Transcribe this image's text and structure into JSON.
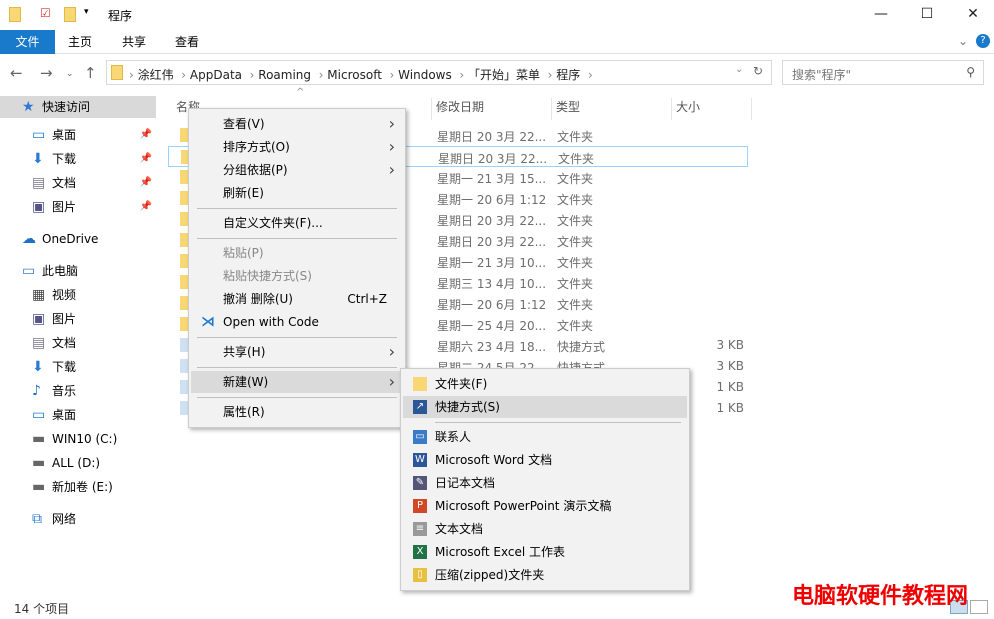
{
  "window": {
    "title": "程序",
    "minimize": "—",
    "maximize": "☐",
    "close": "✕"
  },
  "ribbon": {
    "tabs": [
      "文件",
      "主页",
      "共享",
      "查看"
    ]
  },
  "address": {
    "crumbs": [
      "涂红伟",
      "AppData",
      "Roaming",
      "Microsoft",
      "Windows",
      "「开始」菜单",
      "程序"
    ],
    "refresh": "↻"
  },
  "search": {
    "placeholder": "搜索\"程序\""
  },
  "sidebar": {
    "items": [
      {
        "label": "快速访问",
        "icon": "star-icon"
      },
      {
        "label": "桌面",
        "icon": "desktop-icon",
        "pinned": true
      },
      {
        "label": "下载",
        "icon": "download-icon",
        "pinned": true
      },
      {
        "label": "文档",
        "icon": "document-icon",
        "pinned": true
      },
      {
        "label": "图片",
        "icon": "picture-icon",
        "pinned": true
      },
      {
        "label": "OneDrive",
        "icon": "cloud-icon"
      },
      {
        "label": "此电脑",
        "icon": "computer-icon"
      },
      {
        "label": "视频",
        "icon": "video-icon"
      },
      {
        "label": "图片",
        "icon": "picture-icon"
      },
      {
        "label": "文档",
        "icon": "document-icon"
      },
      {
        "label": "下载",
        "icon": "download-icon"
      },
      {
        "label": "音乐",
        "icon": "music-icon"
      },
      {
        "label": "桌面",
        "icon": "desktop-icon"
      },
      {
        "label": "WIN10 (C:)",
        "icon": "drive-icon"
      },
      {
        "label": "ALL (D:)",
        "icon": "drive-icon"
      },
      {
        "label": "新加卷 (E:)",
        "icon": "drive-icon"
      },
      {
        "label": "网络",
        "icon": "network-icon"
      }
    ]
  },
  "columns": [
    "名称",
    "修改日期",
    "类型",
    "大小"
  ],
  "files": [
    {
      "date": "星期日 20 3月 22...",
      "type": "文件夹",
      "size": ""
    },
    {
      "date": "星期日 20 3月 22...",
      "type": "文件夹",
      "size": ""
    },
    {
      "date": "星期一 21 3月 15...",
      "type": "文件夹",
      "size": ""
    },
    {
      "date": "星期一 20 6月 1:12",
      "type": "文件夹",
      "size": ""
    },
    {
      "date": "星期日 20 3月 22...",
      "type": "文件夹",
      "size": ""
    },
    {
      "date": "星期日 20 3月 22...",
      "type": "文件夹",
      "size": ""
    },
    {
      "date": "星期一 21 3月 10...",
      "type": "文件夹",
      "size": ""
    },
    {
      "date": "星期三 13 4月 10...",
      "type": "文件夹",
      "size": ""
    },
    {
      "date": "星期一 20 6月 1:12",
      "type": "文件夹",
      "size": ""
    },
    {
      "date": "星期一 25 4月 20...",
      "type": "文件夹",
      "size": ""
    },
    {
      "date": "星期六 23 4月 18...",
      "type": "快捷方式",
      "size": "3 KB"
    },
    {
      "date": "星期二 24 5月 22...",
      "type": "快捷方式",
      "size": "3 KB"
    },
    {
      "date": "",
      "type": "",
      "size": "1 KB"
    },
    {
      "date": "",
      "type": "",
      "size": "1 KB"
    }
  ],
  "context_menu": {
    "items": [
      "查看(V)",
      "排序方式(O)",
      "分组依据(P)",
      "刷新(E)",
      "自定义文件夹(F)...",
      "粘贴(P)",
      "粘贴快捷方式(S)",
      "撤消 删除(U)",
      "Open with Code",
      "共享(H)",
      "新建(W)",
      "属性(R)"
    ],
    "undo_shortcut": "Ctrl+Z"
  },
  "new_submenu": {
    "items": [
      "文件夹(F)",
      "快捷方式(S)",
      "联系人",
      "Microsoft Word 文档",
      "日记本文档",
      "Microsoft PowerPoint 演示文稿",
      "文本文档",
      "Microsoft Excel 工作表",
      "压缩(zipped)文件夹"
    ]
  },
  "status": {
    "count": "14 个项目"
  },
  "watermark": "电脑软硬件教程网"
}
